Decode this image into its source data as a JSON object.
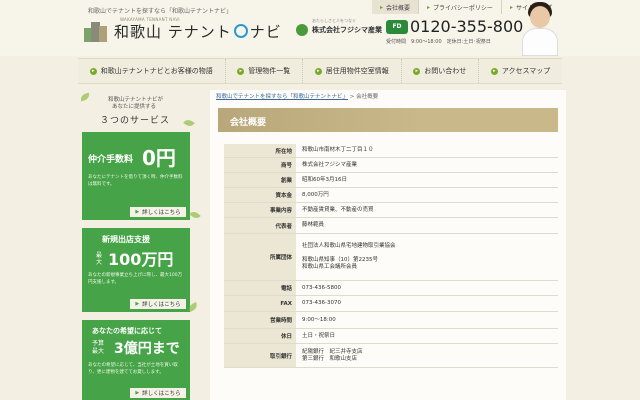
{
  "header": {
    "tagline": "和歌山でテナントを探すなら「和歌山テナントナビ」",
    "logo_sub": "WAKAYAMA TENNANT NAVI",
    "logo_text_a": "和歌山 テナント",
    "logo_text_b": "ナビ",
    "company_sub": "あたらしさと人をつなぐ",
    "company_name": "株式会社フジシマ産業",
    "freedial_label": "FD",
    "phone": "0120-355-800",
    "hours": "受付時間　9:00～18:00　定休日:土日･祝祭日",
    "topnav": [
      "会社概要",
      "プライバシーポリシー",
      "サイトマップ"
    ]
  },
  "mainnav": [
    "和歌山テナントナビとお客様の物語",
    "管理物件一覧",
    "居住用物件空室情報",
    "お問い合わせ",
    "アクセスマップ"
  ],
  "sidebar": {
    "line1": "和歌山テナントナビが",
    "line2": "あなたに提供する",
    "line3": "３つのサービス",
    "cards": [
      {
        "title": "仲介手数料",
        "big": "0円",
        "desc": "あなたにテナントを借りて頂く時、仲介手数料は無料です。",
        "button": "詳しくはこちら"
      },
      {
        "title": "新規出店支援",
        "prefix": "最大",
        "big": "100万円",
        "desc": "あなたの新規事業立ち上げに際し、最大100万円支援します。",
        "button": "詳しくはこちら"
      },
      {
        "title": "あなたの希望に応じて",
        "prefix": "予算 最大",
        "big": "3億円まで",
        "desc": "あなたの希望に応じて、当社が土地を買い取り、更に建物を建ててお貸しします。",
        "button": "詳しくはこちら"
      }
    ]
  },
  "content": {
    "breadcrumb_link": "和歌山でテナントを探すなら「和歌山テナントナビ」",
    "breadcrumb_sep": " > ",
    "breadcrumb_current": "会社概要",
    "title": "会社概要",
    "rows": [
      {
        "label": "所在地",
        "lines": [
          "和歌山市南材木丁二丁目１０"
        ]
      },
      {
        "label": "商号",
        "lines": [
          "株式会社フジシマ産業"
        ]
      },
      {
        "label": "創業",
        "lines": [
          "昭和60年3月16日"
        ]
      },
      {
        "label": "資本金",
        "lines": [
          "8,000万円"
        ]
      },
      {
        "label": "事業内容",
        "lines": [
          "不動産賃貸業、不動産の売買"
        ]
      },
      {
        "label": "代表者",
        "lines": [
          "藤林範員"
        ]
      },
      {
        "label": "所属団体",
        "lines": [
          "社団法人和歌山県宅地建物取引業協会",
          "",
          "和歌山県知事（10）第2235号",
          "和歌山県工会議所会員"
        ]
      },
      {
        "label": "電話",
        "lines": [
          "073-436-5800"
        ]
      },
      {
        "label": "FAX",
        "lines": [
          "073-436-3070"
        ]
      },
      {
        "label": "営業時間",
        "lines": [
          "9:00～18:00"
        ]
      },
      {
        "label": "休日",
        "lines": [
          "土日・祝祭日"
        ]
      },
      {
        "label": "取引銀行",
        "lines": [
          "紀陽銀行　紀三井寺支店",
          "第三銀行　和歌山支店"
        ]
      }
    ]
  },
  "colors": {
    "green": "#46a347",
    "title_bar": "#c9b98a",
    "background": "#f3efe2"
  }
}
